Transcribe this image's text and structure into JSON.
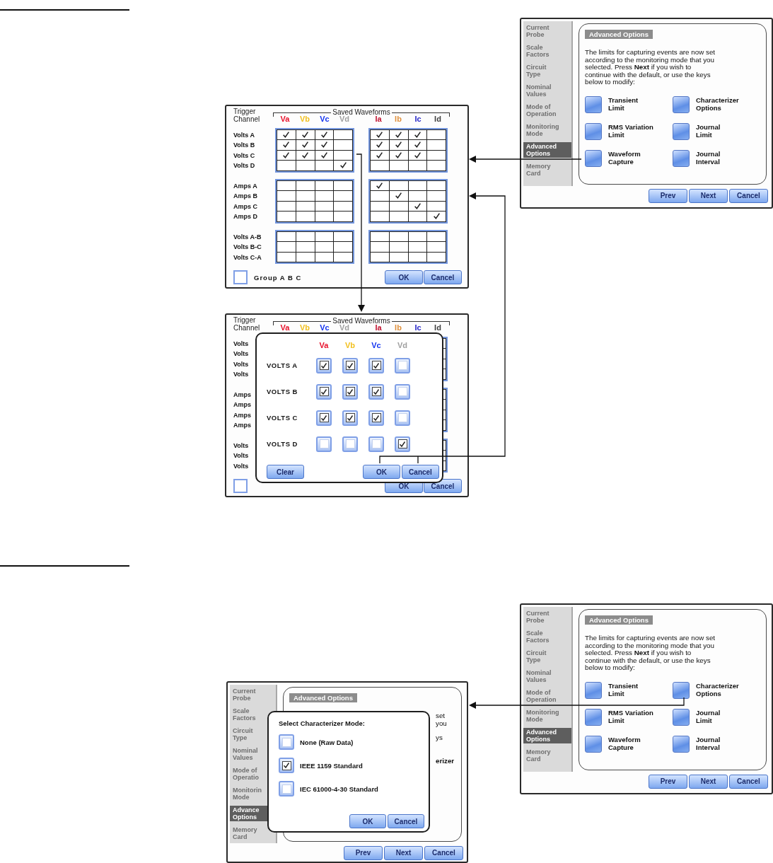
{
  "advanced_options_top": {
    "sidebar": [
      {
        "label": "Current\nProbe",
        "selected": false
      },
      {
        "label": "Scale\nFactors",
        "selected": false
      },
      {
        "label": "Circuit\nType",
        "selected": false
      },
      {
        "label": "Nominal\nValues",
        "selected": false
      },
      {
        "label": "Mode of\nOperation",
        "selected": false
      },
      {
        "label": "Monitoring\nMode",
        "selected": false
      },
      {
        "label": "Advanced\nOptions",
        "selected": true
      },
      {
        "label": "Memory\nCard",
        "selected": false
      }
    ],
    "header": "Advanced Options",
    "description": "The limits for capturing events are now set\naccording to the monitoring mode that you\nselected. Press **Next** if you wish to\ncontinue with the default, or use the keys\nbelow to modify:",
    "options": [
      "Transient\nLimit",
      "Characterizer\nOptions",
      "RMS Variation\nLimit",
      "Journal\nLimit",
      "Waveform\nCapture",
      "Journal\nInterval"
    ],
    "buttons": [
      "Prev",
      "Next",
      "Cancel"
    ]
  },
  "waveform_grid": {
    "trigger_label": "Trigger\nChannel",
    "saved_label": "Saved Waveforms",
    "voltage_columns": [
      {
        "label": "Va",
        "color": "#e8102a"
      },
      {
        "label": "Vb",
        "color": "#f2c01e"
      },
      {
        "label": "Vc",
        "color": "#1434f0"
      },
      {
        "label": "Vd",
        "color": "#a0a0a0"
      }
    ],
    "current_columns": [
      {
        "label": "Ia",
        "color": "#c0102e"
      },
      {
        "label": "Ib",
        "color": "#e0903c"
      },
      {
        "label": "Ic",
        "color": "#2424c8"
      },
      {
        "label": "Id",
        "color": "#404040"
      }
    ],
    "groups": [
      {
        "rows": [
          {
            "label": "Volts A",
            "voltage": [
              true,
              true,
              true,
              false
            ],
            "current": [
              true,
              true,
              true,
              false
            ]
          },
          {
            "label": "Volts B",
            "voltage": [
              true,
              true,
              true,
              false
            ],
            "current": [
              true,
              true,
              true,
              false
            ]
          },
          {
            "label": "Volts C",
            "voltage": [
              true,
              true,
              true,
              false
            ],
            "current": [
              true,
              true,
              true,
              false
            ]
          },
          {
            "label": "Volts D",
            "voltage": [
              false,
              false,
              false,
              true
            ],
            "current": [
              false,
              false,
              false,
              false
            ]
          }
        ]
      },
      {
        "rows": [
          {
            "label": "Amps A",
            "voltage": [
              false,
              false,
              false,
              false
            ],
            "current": [
              true,
              false,
              false,
              false
            ]
          },
          {
            "label": "Amps B",
            "voltage": [
              false,
              false,
              false,
              false
            ],
            "current": [
              false,
              true,
              false,
              false
            ]
          },
          {
            "label": "Amps C",
            "voltage": [
              false,
              false,
              false,
              false
            ],
            "current": [
              false,
              false,
              true,
              false
            ]
          },
          {
            "label": "Amps D",
            "voltage": [
              false,
              false,
              false,
              false
            ],
            "current": [
              false,
              false,
              false,
              true
            ]
          }
        ]
      },
      {
        "rows": [
          {
            "label": "Volts A-B",
            "voltage": [
              false,
              false,
              false,
              false
            ],
            "current": [
              false,
              false,
              false,
              false
            ]
          },
          {
            "label": "Volts B-C",
            "voltage": [
              false,
              false,
              false,
              false
            ],
            "current": [
              false,
              false,
              false,
              false
            ]
          },
          {
            "label": "Volts C-A",
            "voltage": [
              false,
              false,
              false,
              false
            ],
            "current": [
              false,
              false,
              false,
              false
            ]
          }
        ]
      }
    ],
    "group_option": {
      "label": "Group A B C",
      "checked": false
    },
    "buttons": [
      "OK",
      "Cancel"
    ]
  },
  "waveform_dialog": {
    "trigger_label": "Trigger\nChannel",
    "saved_label": "Saved Waveforms",
    "voltage_columns": [
      {
        "label": "Va",
        "color": "#e8102a"
      },
      {
        "label": "Vb",
        "color": "#f2c01e"
      },
      {
        "label": "Vc",
        "color": "#1434f0"
      },
      {
        "label": "Vd",
        "color": "#a0a0a0"
      }
    ],
    "current_columns": [
      {
        "label": "Ia",
        "color": "#c0102e"
      },
      {
        "label": "Ib",
        "color": "#e0903c"
      },
      {
        "label": "Ic",
        "color": "#2424c8"
      },
      {
        "label": "Id",
        "color": "#404040"
      }
    ],
    "groups": [
      {
        "rows": [
          {
            "label": "Volts"
          },
          {
            "label": "Volts"
          },
          {
            "label": "Volts"
          },
          {
            "label": "Volts"
          }
        ]
      },
      {
        "rows": [
          {
            "label": "Amps"
          },
          {
            "label": "Amps"
          },
          {
            "label": "Amps"
          },
          {
            "label": "Amps"
          }
        ]
      },
      {
        "rows": [
          {
            "label": "Volts"
          },
          {
            "label": "Volts"
          },
          {
            "label": "Volts"
          }
        ]
      }
    ],
    "group_option": {
      "checked": false
    },
    "buttons": [
      "OK",
      "Cancel"
    ],
    "dialog": {
      "columns": [
        {
          "label": "Va",
          "color": "#e8102a"
        },
        {
          "label": "Vb",
          "color": "#f2c01e"
        },
        {
          "label": "Vc",
          "color": "#1434f0"
        },
        {
          "label": "Vd",
          "color": "#a0a0a0"
        }
      ],
      "rows": [
        {
          "label": "VOLTS A",
          "checks": [
            true,
            true,
            true,
            false
          ]
        },
        {
          "label": "VOLTS B",
          "checks": [
            true,
            true,
            true,
            false
          ]
        },
        {
          "label": "VOLTS C",
          "checks": [
            true,
            true,
            true,
            false
          ]
        },
        {
          "label": "VOLTS D",
          "checks": [
            false,
            false,
            false,
            true
          ]
        }
      ],
      "buttons": [
        "Clear",
        "OK",
        "Cancel"
      ]
    }
  },
  "advanced_options_bottom": {
    "sidebar": [
      {
        "label": "Current\nProbe",
        "selected": false
      },
      {
        "label": "Scale\nFactors",
        "selected": false
      },
      {
        "label": "Circuit\nType",
        "selected": false
      },
      {
        "label": "Nominal\nValues",
        "selected": false
      },
      {
        "label": "Mode of\nOperation",
        "selected": false
      },
      {
        "label": "Monitoring\nMode",
        "selected": false
      },
      {
        "label": "Advanced\nOptions",
        "selected": true
      },
      {
        "label": "Memory\nCard",
        "selected": false
      }
    ],
    "header": "Advanced Options",
    "description": "The limits for capturing events are now set\naccording to the monitoring mode that you\nselected. Press **Next** if you wish to\ncontinue with the default, or use the keys\nbelow to modify:",
    "options": [
      "Transient\nLimit",
      "Characterizer\nOptions",
      "RMS Variation\nLimit",
      "Journal\nLimit",
      "Waveform\nCapture",
      "Journal\nInterval"
    ],
    "buttons": [
      "Prev",
      "Next",
      "Cancel"
    ]
  },
  "characterizer_screen": {
    "sidebar": [
      {
        "label": "Current\nProbe",
        "selected": false
      },
      {
        "label": "Scale\nFactors",
        "selected": false
      },
      {
        "label": "Circuit\nType",
        "selected": false
      },
      {
        "label": "Nominal\nValues",
        "selected": false
      },
      {
        "label": "Mode of\nOperatio",
        "selected": false
      },
      {
        "label": "Monitorin\nMode",
        "selected": false
      },
      {
        "label": "Advance\nOptions",
        "selected": true
      },
      {
        "label": "Memory\nCard",
        "selected": false
      }
    ],
    "header": "Advanced Options",
    "covered_text": [
      {
        "text": "set",
        "kind": "text"
      },
      {
        "text": "you",
        "kind": "text"
      },
      {
        "text": "ys",
        "kind": "text"
      },
      {
        "text": "erizer",
        "kind": "option"
      }
    ],
    "buttons": [
      "Prev",
      "Next",
      "Cancel"
    ],
    "dialog": {
      "title": "Select Characterizer Mode:",
      "options": [
        {
          "label": "None (Raw Data)",
          "checked": false
        },
        {
          "label": "IEEE 1159 Standard",
          "checked": true
        },
        {
          "label": "IEC 61000-4-30 Standard",
          "checked": false
        }
      ],
      "buttons": [
        "OK",
        "Cancel"
      ]
    }
  }
}
